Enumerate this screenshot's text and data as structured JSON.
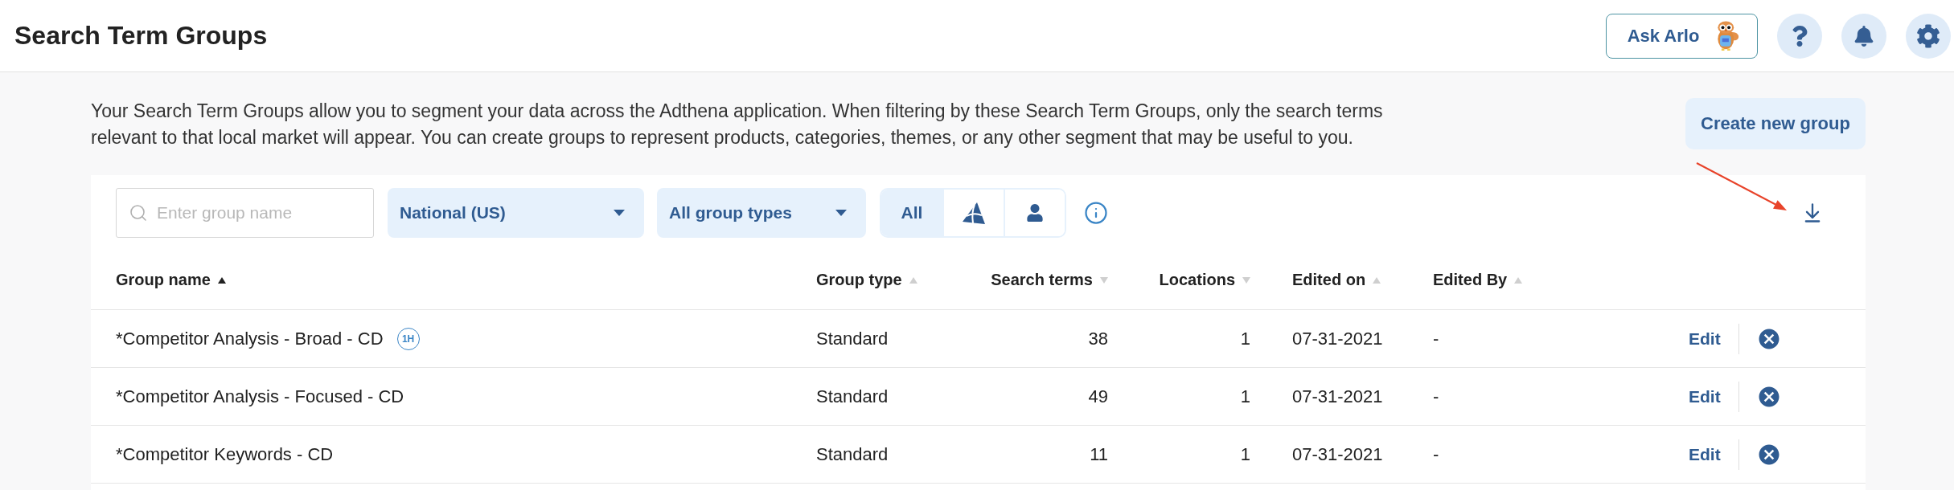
{
  "header": {
    "title": "Search Term Groups",
    "assistant_button": "Ask Arlo"
  },
  "intro": {
    "description": "Your Search Term Groups allow you to segment your data across the Adthena application. When filtering by these Search Term Groups, only the search terms relevant to that local market will appear. You can create groups to represent products, categories, themes, or any other segment that may be useful to you.",
    "create_button": "Create new group"
  },
  "filters": {
    "search": {
      "placeholder": "Enter group name"
    },
    "market": {
      "value": "National (US)"
    },
    "group_type": {
      "value": "All group types"
    },
    "view_toggle": [
      {
        "kind": "text",
        "label": "All",
        "selected": true
      },
      {
        "kind": "pyramid",
        "selected": false
      },
      {
        "kind": "person",
        "selected": false
      }
    ]
  },
  "table": {
    "columns": [
      {
        "label": "Group name",
        "ascending": true,
        "active": true
      },
      {
        "label": "Group type",
        "ascending": true,
        "active": false
      },
      {
        "label": "Search terms",
        "ascending": false,
        "active": false
      },
      {
        "label": "Locations",
        "ascending": false,
        "active": false
      },
      {
        "label": "Edited on",
        "ascending": true,
        "active": false
      },
      {
        "label": "Edited By",
        "ascending": true,
        "active": false
      }
    ],
    "rows": [
      {
        "name": "*Competitor Analysis - Broad - CD",
        "badge": "1H",
        "type": "Standard",
        "search_terms": "38",
        "locations": "1",
        "edited_on": "07-31-2021",
        "edited_by": "-",
        "action": "Edit"
      },
      {
        "name": "*Competitor Analysis - Focused - CD",
        "type": "Standard",
        "search_terms": "49",
        "locations": "1",
        "edited_on": "07-31-2021",
        "edited_by": "-",
        "action": "Edit"
      },
      {
        "name": "*Competitor Keywords - CD",
        "type": "Standard",
        "search_terms": "11",
        "locations": "1",
        "edited_on": "07-31-2021",
        "edited_by": "-",
        "action": "Edit"
      }
    ]
  }
}
